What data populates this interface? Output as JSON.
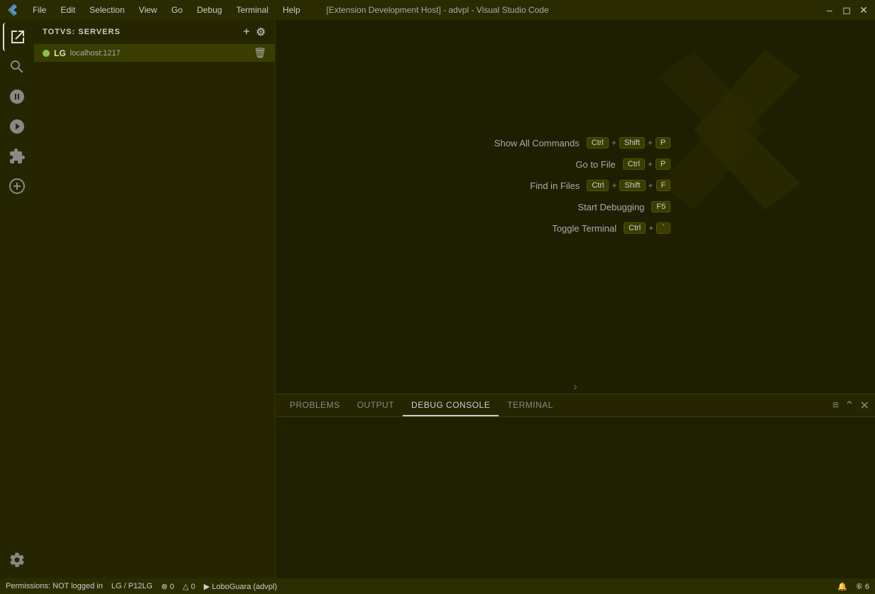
{
  "titlebar": {
    "title": "[Extension Development Host] - advpl - Visual Studio Code",
    "menu": [
      "File",
      "Edit",
      "Selection",
      "View",
      "Go",
      "Debug",
      "Terminal",
      "Help"
    ]
  },
  "sidebar": {
    "header": "TOTVS: SERVERS",
    "add_label": "+",
    "settings_label": "⚙",
    "server": {
      "name": "LG",
      "host": "localhost:1217",
      "status": "connected"
    }
  },
  "welcome": {
    "shortcuts": [
      {
        "label": "Show All Commands",
        "keys": [
          "Ctrl",
          "+",
          "Shift",
          "+",
          "P"
        ]
      },
      {
        "label": "Go to File",
        "keys": [
          "Ctrl",
          "+",
          "P"
        ]
      },
      {
        "label": "Find in Files",
        "keys": [
          "Ctrl",
          "+",
          "Shift",
          "+",
          "F"
        ]
      },
      {
        "label": "Start Debugging",
        "keys": [
          "F5"
        ]
      },
      {
        "label": "Toggle Terminal",
        "keys": [
          "Ctrl",
          "+",
          "`"
        ]
      }
    ]
  },
  "panel": {
    "tabs": [
      "PROBLEMS",
      "OUTPUT",
      "DEBUG CONSOLE",
      "TERMINAL"
    ],
    "active_tab": "DEBUG CONSOLE"
  },
  "statusbar": {
    "permissions": "Permissions: NOT logged in",
    "profile": "LG / P12LG",
    "errors": "⊗ 0",
    "warnings": "△ 0",
    "run": "▶ LoboGuara (advpl)",
    "bell": "🔔",
    "count": "⑥ 6"
  }
}
